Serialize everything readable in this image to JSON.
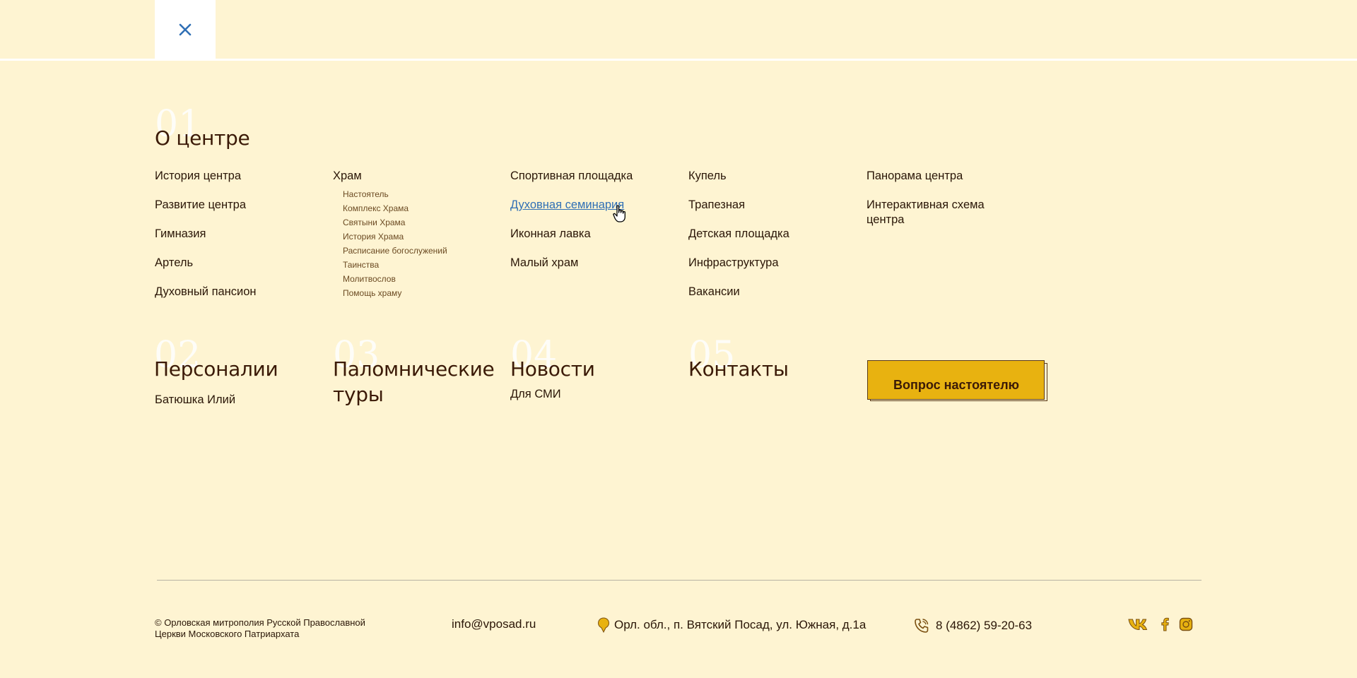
{
  "sections": {
    "about": {
      "num": "01",
      "title": "О центре",
      "col1": [
        "История центра",
        "Развитие центра",
        "Гимназия",
        "Артель",
        "Духовный пансион"
      ],
      "col2_head": "Храм",
      "col2_sub": [
        "Настоятель",
        "Комплекс Храма",
        "Святыни Храма",
        "История Храма",
        "Расписание богослужений",
        "Таинства",
        "Молитвослов",
        "Помощь храму"
      ],
      "col3": [
        "Спортивная площадка",
        "Духовная семинария",
        "Иконная лавка",
        "Малый храм"
      ],
      "col4": [
        "Купель",
        "Трапезная",
        "Детская площадка",
        "Инфраструктура",
        "Вакансии"
      ],
      "col5": [
        "Панорама центра",
        "Интерактивная схема центра"
      ]
    },
    "personalities": {
      "num": "02",
      "title": "Персоналии",
      "items": [
        "Батюшка Илий"
      ]
    },
    "pilgrim": {
      "num": "03",
      "title": "Паломнические туры"
    },
    "news": {
      "num": "04",
      "title": "Новости",
      "items": [
        "Для СМИ"
      ]
    },
    "contacts": {
      "num": "05",
      "title": "Контакты"
    }
  },
  "ask_button": "Вопрос настоятелю",
  "footer": {
    "copyright": "© Орловская митрополия Русской Православной Церкви Московского Патриархата",
    "email": "info@vposad.ru",
    "address": "Орл. обл.,  п. Вятский Посад, ул. Южная, д.1а",
    "phone": "8 (4862) 59-20-63"
  },
  "icons": {
    "close": "close-icon",
    "pin": "map-pin-icon",
    "phone": "phone-icon",
    "vk": "vk-icon",
    "facebook": "facebook-icon",
    "instagram": "instagram-icon"
  },
  "colors": {
    "background": "#fef4d2",
    "accent": "#e8b210",
    "link_active": "#2f6fb5",
    "text": "#2a1607"
  }
}
